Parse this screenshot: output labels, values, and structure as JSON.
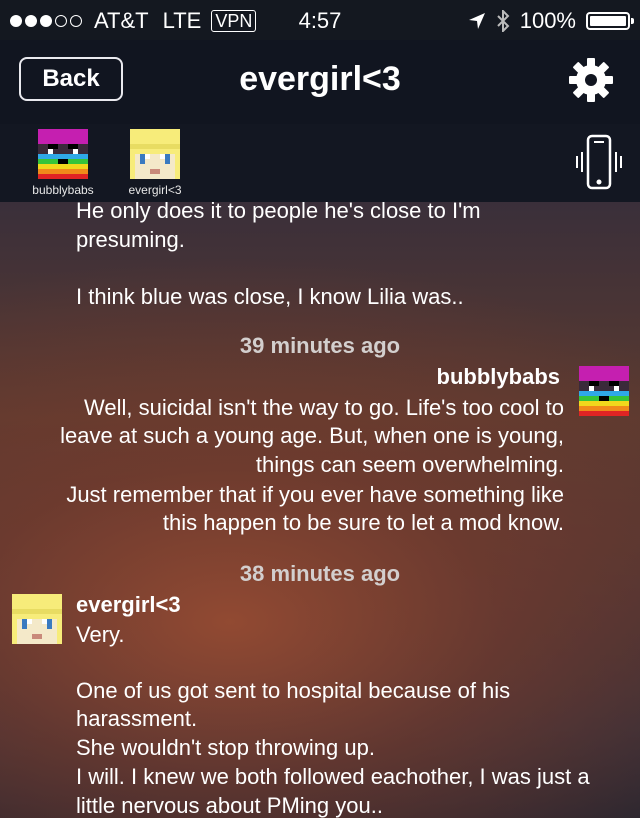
{
  "status_bar": {
    "carrier": "AT&T",
    "network": "LTE",
    "vpn": "VPN",
    "time": "4:57",
    "battery": "100%",
    "battery_level": 1.0,
    "signal_bars_filled": 3,
    "signal_bars_total": 5
  },
  "header": {
    "back_label": "Back",
    "title": "evergirl<3"
  },
  "participants": [
    {
      "name": "bubblybabs"
    },
    {
      "name": "evergirl<3"
    }
  ],
  "messages": {
    "group1_lines": [
      "He only does it to people he's close to I'm",
      "presuming.",
      "",
      "I think blue was close, I know Lilia was.."
    ],
    "timestamp1": "39 minutes ago",
    "sender2": "bubblybabs",
    "group2_lines": [
      "Well, suicidal isn't the way to go.  Life's too cool to",
      "leave at such a young age.  But, when one is young,",
      "things can seem overwhelming.",
      "Just remember that if you ever have something like",
      "this happen to be sure to let a mod know."
    ],
    "timestamp2": "38 minutes ago",
    "sender3": "evergirl<3",
    "group3_lines": [
      "Very.",
      "",
      "One of us got sent to hospital because of his",
      "harassment.",
      "She wouldn't stop throwing up.",
      "I will. I knew we both followed eachother, I was just a",
      "little nervous about PMing you.."
    ]
  },
  "colors": {
    "header_bg": "#111520",
    "timestamp": "#d3cfce"
  }
}
